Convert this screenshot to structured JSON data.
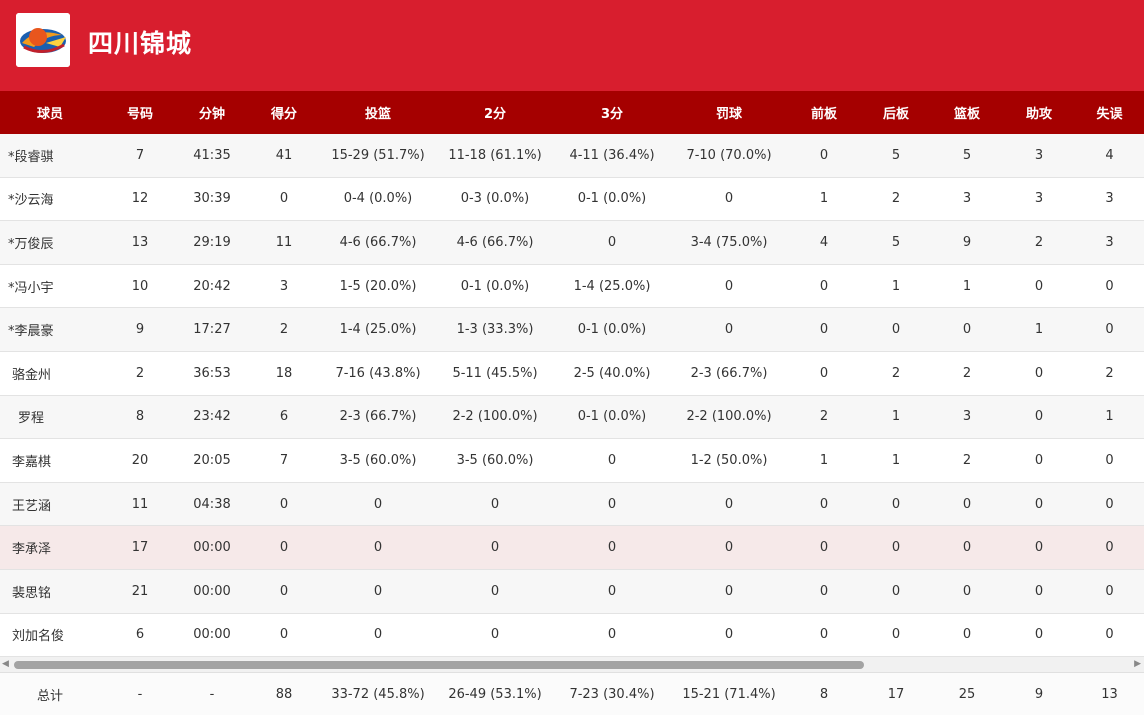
{
  "team": {
    "name": "四川锦城",
    "logo_icon": "team-logo-icon"
  },
  "columns": [
    "球员",
    "号码",
    "分钟",
    "得分",
    "投篮",
    "2分",
    "3分",
    "罚球",
    "前板",
    "后板",
    "篮板",
    "助攻",
    "失误"
  ],
  "players": [
    {
      "name": "*段睿骐",
      "num": "7",
      "min": "41:35",
      "pts": "41",
      "fg": "15-29 (51.7%)",
      "two": "11-18 (61.1%)",
      "three": "4-11 (36.4%)",
      "ft": "7-10 (70.0%)",
      "oreb": "0",
      "dreb": "5",
      "reb": "5",
      "ast": "3",
      "tov": "4"
    },
    {
      "name": "*沙云海",
      "num": "12",
      "min": "30:39",
      "pts": "0",
      "fg": "0-4 (0.0%)",
      "two": "0-3 (0.0%)",
      "three": "0-1 (0.0%)",
      "ft": "0",
      "oreb": "1",
      "dreb": "2",
      "reb": "3",
      "ast": "3",
      "tov": "3"
    },
    {
      "name": "*万俊辰",
      "num": "13",
      "min": "29:19",
      "pts": "11",
      "fg": "4-6 (66.7%)",
      "two": "4-6 (66.7%)",
      "three": "0",
      "ft": "3-4 (75.0%)",
      "oreb": "4",
      "dreb": "5",
      "reb": "9",
      "ast": "2",
      "tov": "3"
    },
    {
      "name": "*冯小宇",
      "num": "10",
      "min": "20:42",
      "pts": "3",
      "fg": "1-5 (20.0%)",
      "two": "0-1 (0.0%)",
      "three": "1-4 (25.0%)",
      "ft": "0",
      "oreb": "0",
      "dreb": "1",
      "reb": "1",
      "ast": "0",
      "tov": "0"
    },
    {
      "name": "*李晨豪",
      "num": "9",
      "min": "17:27",
      "pts": "2",
      "fg": "1-4 (25.0%)",
      "two": "1-3 (33.3%)",
      "three": "0-1 (0.0%)",
      "ft": "0",
      "oreb": "0",
      "dreb": "0",
      "reb": "0",
      "ast": "1",
      "tov": "0"
    },
    {
      "name": "骆金州",
      "num": "2",
      "min": "36:53",
      "pts": "18",
      "fg": "7-16 (43.8%)",
      "two": "5-11 (45.5%)",
      "three": "2-5 (40.0%)",
      "ft": "2-3 (66.7%)",
      "oreb": "0",
      "dreb": "2",
      "reb": "2",
      "ast": "0",
      "tov": "2"
    },
    {
      "name": "罗程",
      "num": "8",
      "min": "23:42",
      "pts": "6",
      "fg": "2-3 (66.7%)",
      "two": "2-2 (100.0%)",
      "three": "0-1 (0.0%)",
      "ft": "2-2 (100.0%)",
      "oreb": "2",
      "dreb": "1",
      "reb": "3",
      "ast": "0",
      "tov": "1"
    },
    {
      "name": "李嘉棋",
      "num": "20",
      "min": "20:05",
      "pts": "7",
      "fg": "3-5 (60.0%)",
      "two": "3-5 (60.0%)",
      "three": "0",
      "ft": "1-2 (50.0%)",
      "oreb": "1",
      "dreb": "1",
      "reb": "2",
      "ast": "0",
      "tov": "0"
    },
    {
      "name": "王艺涵",
      "num": "11",
      "min": "04:38",
      "pts": "0",
      "fg": "0",
      "two": "0",
      "three": "0",
      "ft": "0",
      "oreb": "0",
      "dreb": "0",
      "reb": "0",
      "ast": "0",
      "tov": "0"
    },
    {
      "name": "李承泽",
      "num": "17",
      "min": "00:00",
      "pts": "0",
      "fg": "0",
      "two": "0",
      "three": "0",
      "ft": "0",
      "oreb": "0",
      "dreb": "0",
      "reb": "0",
      "ast": "0",
      "tov": "0"
    },
    {
      "name": "裴思铭",
      "num": "21",
      "min": "00:00",
      "pts": "0",
      "fg": "0",
      "two": "0",
      "three": "0",
      "ft": "0",
      "oreb": "0",
      "dreb": "0",
      "reb": "0",
      "ast": "0",
      "tov": "0"
    },
    {
      "name": "刘加名俊",
      "num": "6",
      "min": "00:00",
      "pts": "0",
      "fg": "0",
      "two": "0",
      "three": "0",
      "ft": "0",
      "oreb": "0",
      "dreb": "0",
      "reb": "0",
      "ast": "0",
      "tov": "0"
    }
  ],
  "totals": {
    "name": "总计",
    "num": "-",
    "min": "-",
    "pts": "88",
    "fg": "33-72 (45.8%)",
    "two": "26-49 (53.1%)",
    "three": "7-23 (30.4%)",
    "ft": "15-21 (71.4%)",
    "oreb": "8",
    "dreb": "17",
    "reb": "25",
    "ast": "9",
    "tov": "13"
  },
  "colors": {
    "header_bg": "#d81e2e",
    "table_header_bg": "#a50000",
    "highlight_row": "#f6e9e9"
  },
  "scrollbar": {
    "left_icon": "scroll-left-arrow-icon",
    "right_icon": "scroll-right-arrow-icon"
  }
}
